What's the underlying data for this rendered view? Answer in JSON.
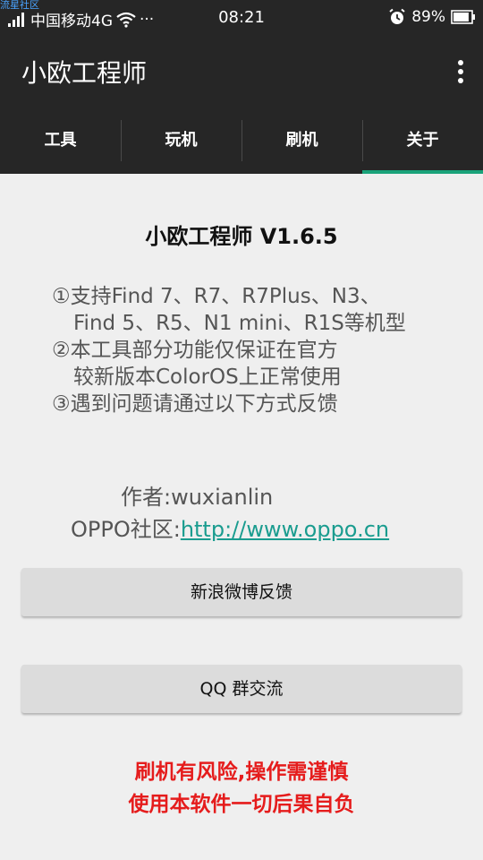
{
  "status_bar": {
    "watermark": "流星社区",
    "carrier": "中国移动4G",
    "more": "···",
    "time": "08:21",
    "battery": "89%",
    "battery_level": 0.89
  },
  "app_bar": {
    "title": "小欧工程师"
  },
  "tabs": [
    {
      "label": "工具"
    },
    {
      "label": "玩机"
    },
    {
      "label": "刷机"
    },
    {
      "label": "关于"
    }
  ],
  "active_tab": "关于",
  "about": {
    "version_title": "小欧工程师 V1.6.5",
    "notes": [
      "①支持Find 7、R7、R7Plus、N3、",
      "Find 5、R5、N1 mini、R1S等机型",
      "②本工具部分功能仅保证在官方",
      "较新版本ColorOS上正常使用",
      "③遇到问题请通过以下方式反馈"
    ],
    "author_label": "作者:",
    "author_value": "wuxianlin",
    "community_label": "OPPO社区:",
    "community_link": "http://www.oppo.cn"
  },
  "buttons": {
    "weibo": "新浪微博反馈",
    "qq": "QQ 群交流"
  },
  "warnings": [
    "刷机有风险,操作需谨慎",
    "使用本软件一切后果自负"
  ],
  "colors": {
    "accent": "#1aa37a",
    "warning": "#e51c1c",
    "link": "#1a9c8f",
    "bar": "#262626"
  }
}
